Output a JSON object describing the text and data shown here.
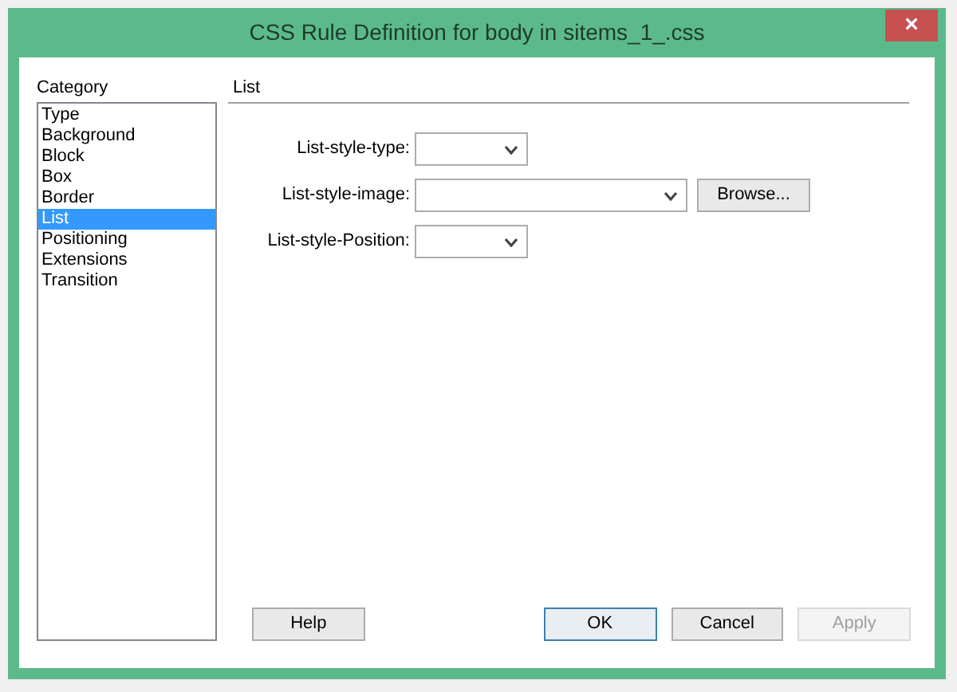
{
  "window": {
    "title": "CSS Rule Definition for body in sitems_1_.css",
    "close": "×"
  },
  "category": {
    "label": "Category",
    "items": [
      {
        "label": "Type",
        "selected": false
      },
      {
        "label": "Background",
        "selected": false
      },
      {
        "label": "Block",
        "selected": false
      },
      {
        "label": "Box",
        "selected": false
      },
      {
        "label": "Border",
        "selected": false
      },
      {
        "label": "List",
        "selected": true
      },
      {
        "label": "Positioning",
        "selected": false
      },
      {
        "label": "Extensions",
        "selected": false
      },
      {
        "label": "Transition",
        "selected": false
      }
    ]
  },
  "panel": {
    "title": "List",
    "fields": [
      {
        "label": "List-style-type:",
        "kind": "narrow"
      },
      {
        "label": "List-style-image:",
        "kind": "wide",
        "button": "Browse..."
      },
      {
        "label": "List-style-Position:",
        "kind": "narrow"
      }
    ]
  },
  "buttons": [
    {
      "label": "Help",
      "kind": "help",
      "disabled": false
    },
    {
      "label": "OK",
      "kind": "default",
      "disabled": false
    },
    {
      "label": "Cancel",
      "kind": "normal",
      "disabled": false
    },
    {
      "label": "Apply",
      "kind": "normal",
      "disabled": true
    }
  ]
}
